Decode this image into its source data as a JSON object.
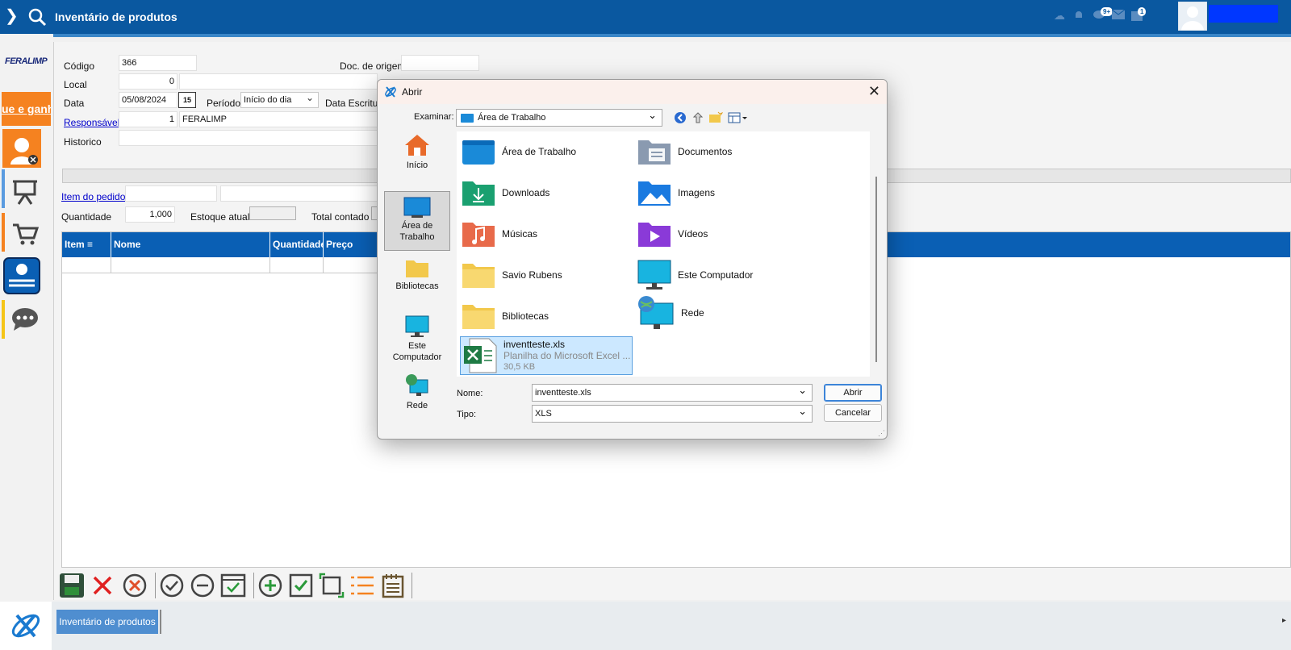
{
  "header": {
    "title": "Inventário de produtos",
    "notif_badge": "9+",
    "calendar_badge": "1"
  },
  "sidebar": {
    "brand": "FERALIMP",
    "promo": "ue e ganh"
  },
  "form": {
    "codigo_label": "Código",
    "codigo_value": "366",
    "local_label": "Local",
    "local_value": "0",
    "data_label": "Data",
    "data_value": "05/08/2024",
    "periodo_label": "Período",
    "periodo_value": "Início do dia",
    "doc_origem_label": "Doc. de origem",
    "data_escritura_label": "Data Escritura",
    "responsavel_label": "Responsável",
    "responsavel_code": "1",
    "responsavel_name": "FERALIMP",
    "historico_label": "Historico",
    "item_pedido_label": "Item do pedido",
    "quantidade_label": "Quantidade",
    "quantidade_value": "1,000",
    "estoque_label": "Estoque atual",
    "total_label": "Total contado"
  },
  "grid": {
    "columns": [
      "Item",
      "Nome",
      "Quantidade",
      "Preço"
    ]
  },
  "taskbar": {
    "item": "Inventário de produtos"
  },
  "dialog": {
    "title": "Abrir",
    "look_in_label": "Examinar:",
    "look_in_value": "Área de Trabalho",
    "places": [
      "Início",
      "Área de Trabalho",
      "Bibliotecas",
      "Este Computador",
      "Rede"
    ],
    "files": [
      {
        "name": "Área de Trabalho",
        "icon": "desktop-icon"
      },
      {
        "name": "Documentos",
        "icon": "documents-icon"
      },
      {
        "name": "Downloads",
        "icon": "downloads-icon"
      },
      {
        "name": "Imagens",
        "icon": "pictures-icon"
      },
      {
        "name": "Músicas",
        "icon": "music-icon"
      },
      {
        "name": "Vídeos",
        "icon": "videos-icon"
      },
      {
        "name": "Savio Rubens",
        "icon": "folder-icon"
      },
      {
        "name": "Este Computador",
        "icon": "computer-icon"
      },
      {
        "name": "Bibliotecas",
        "icon": "folder-icon"
      },
      {
        "name": "Rede",
        "icon": "network-icon"
      }
    ],
    "selected_file": {
      "name": "inventteste.xls",
      "type": "Planilha do Microsoft Excel ...",
      "size": "30,5 KB"
    },
    "name_label": "Nome:",
    "name_value": "inventteste.xls",
    "type_label": "Tipo:",
    "type_value": "XLS",
    "open_button": "Abrir",
    "cancel_button": "Cancelar"
  }
}
